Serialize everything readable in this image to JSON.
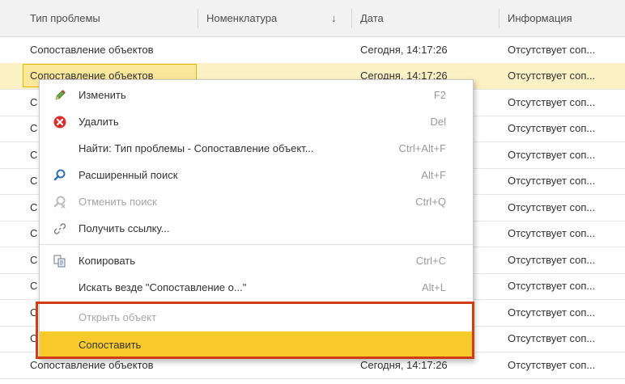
{
  "table": {
    "columns": [
      "Тип проблемы",
      "Номенклатура",
      "Дата",
      "Информация"
    ],
    "sort_indicator": "↓",
    "rows": [
      {
        "type": "Сопоставление объектов",
        "nomenclature": "",
        "date": "Сегодня, 14:17:26",
        "info": "Отсутствует соп..."
      },
      {
        "type": "Сопоставление объектов",
        "nomenclature": "",
        "date": "Сегодня, 14:17:26",
        "info": "Отсутствует соп..."
      },
      {
        "type": "С",
        "nomenclature": "",
        "date": "",
        "info": "Отсутствует соп..."
      },
      {
        "type": "С",
        "nomenclature": "",
        "date": "",
        "info": "Отсутствует соп..."
      },
      {
        "type": "С",
        "nomenclature": "",
        "date": "",
        "info": "Отсутствует соп..."
      },
      {
        "type": "С",
        "nomenclature": "",
        "date": "",
        "info": "Отсутствует соп..."
      },
      {
        "type": "С",
        "nomenclature": "",
        "date": "",
        "info": "Отсутствует соп..."
      },
      {
        "type": "С",
        "nomenclature": "",
        "date": "",
        "info": "Отсутствует соп..."
      },
      {
        "type": "С",
        "nomenclature": "",
        "date": "",
        "info": "Отсутствует соп..."
      },
      {
        "type": "С",
        "nomenclature": "",
        "date": "",
        "info": "Отсутствует соп..."
      },
      {
        "type": "С",
        "nomenclature": "",
        "date": "",
        "info": "Отсутствует соп..."
      },
      {
        "type": "С",
        "nomenclature": "",
        "date": "",
        "info": "Отсутствует соп..."
      },
      {
        "type": "Сопоставление объектов",
        "nomenclature": "",
        "date": "Сегодня, 14:17:26",
        "info": "Отсутствует соп..."
      }
    ]
  },
  "context_menu": {
    "items": [
      {
        "label": "Изменить",
        "shortcut": "F2",
        "icon": "pencil-icon"
      },
      {
        "label": "Удалить",
        "shortcut": "Del",
        "icon": "delete-icon"
      },
      {
        "label": "Найти: Тип проблемы - Сопоставление объект...",
        "shortcut": "Ctrl+Alt+F",
        "icon": ""
      },
      {
        "label": "Расширенный поиск",
        "shortcut": "Alt+F",
        "icon": "search-icon"
      },
      {
        "label": "Отменить поиск",
        "shortcut": "Ctrl+Q",
        "icon": "cancel-search-icon"
      },
      {
        "label": "Получить ссылку...",
        "shortcut": "",
        "icon": "link-icon"
      },
      {
        "label": "Копировать",
        "shortcut": "Ctrl+C",
        "icon": "copy-icon"
      },
      {
        "label": "Искать везде \"Сопоставление о...\"",
        "shortcut": "Alt+L",
        "icon": ""
      },
      {
        "label": "Открыть объект",
        "shortcut": "",
        "icon": ""
      },
      {
        "label": "Сопоставить",
        "shortcut": "",
        "icon": ""
      }
    ]
  },
  "colors": {
    "selected_row": "#fbf1c4",
    "menu_highlight": "#f9cb2a",
    "callout_border": "#cf3d14"
  }
}
